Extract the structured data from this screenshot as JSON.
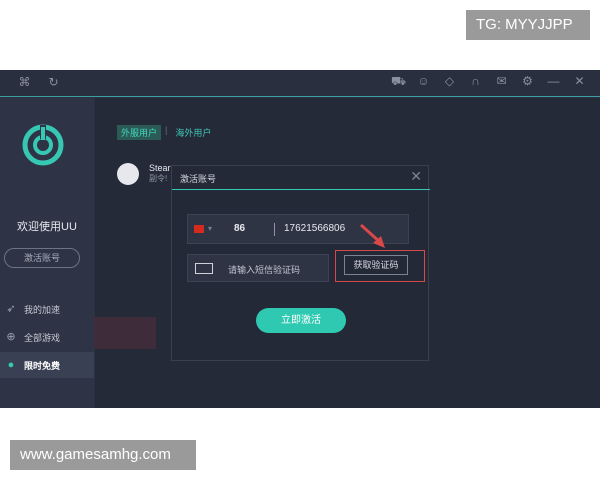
{
  "watermarks": {
    "top": "TG: MYYJJPP",
    "bottom": "www.gamesamhg.com"
  },
  "titlebar": {
    "icons": [
      "gamepad-icon",
      "refresh-icon",
      "cart-icon",
      "chat-icon",
      "tag-icon",
      "headset-icon",
      "mail-icon",
      "settings-icon",
      "minimize-icon",
      "close-icon"
    ]
  },
  "sidebar": {
    "welcome": "欢迎使用UU",
    "activate_button": "激活账号",
    "items": [
      {
        "label": "我的加速",
        "icon": "rocket-icon"
      },
      {
        "label": "全部游戏",
        "icon": "gamepad-icon"
      },
      {
        "label": "限时免费",
        "icon": "gift-icon"
      }
    ]
  },
  "main": {
    "tabs": [
      {
        "label": "外服用户"
      },
      {
        "label": "海外用户"
      }
    ],
    "game": {
      "name": "Stear",
      "sub": "副令!"
    }
  },
  "dialog": {
    "title": "激活账号",
    "country_code": "86",
    "phone": "17621566806",
    "code_placeholder": "请输入短信验证码",
    "get_code_button": "获取验证码",
    "submit_button": "立即激活"
  },
  "colors": {
    "accent": "#2fc9b1",
    "highlight": "#d84848",
    "app_bg": "#2b3042"
  }
}
